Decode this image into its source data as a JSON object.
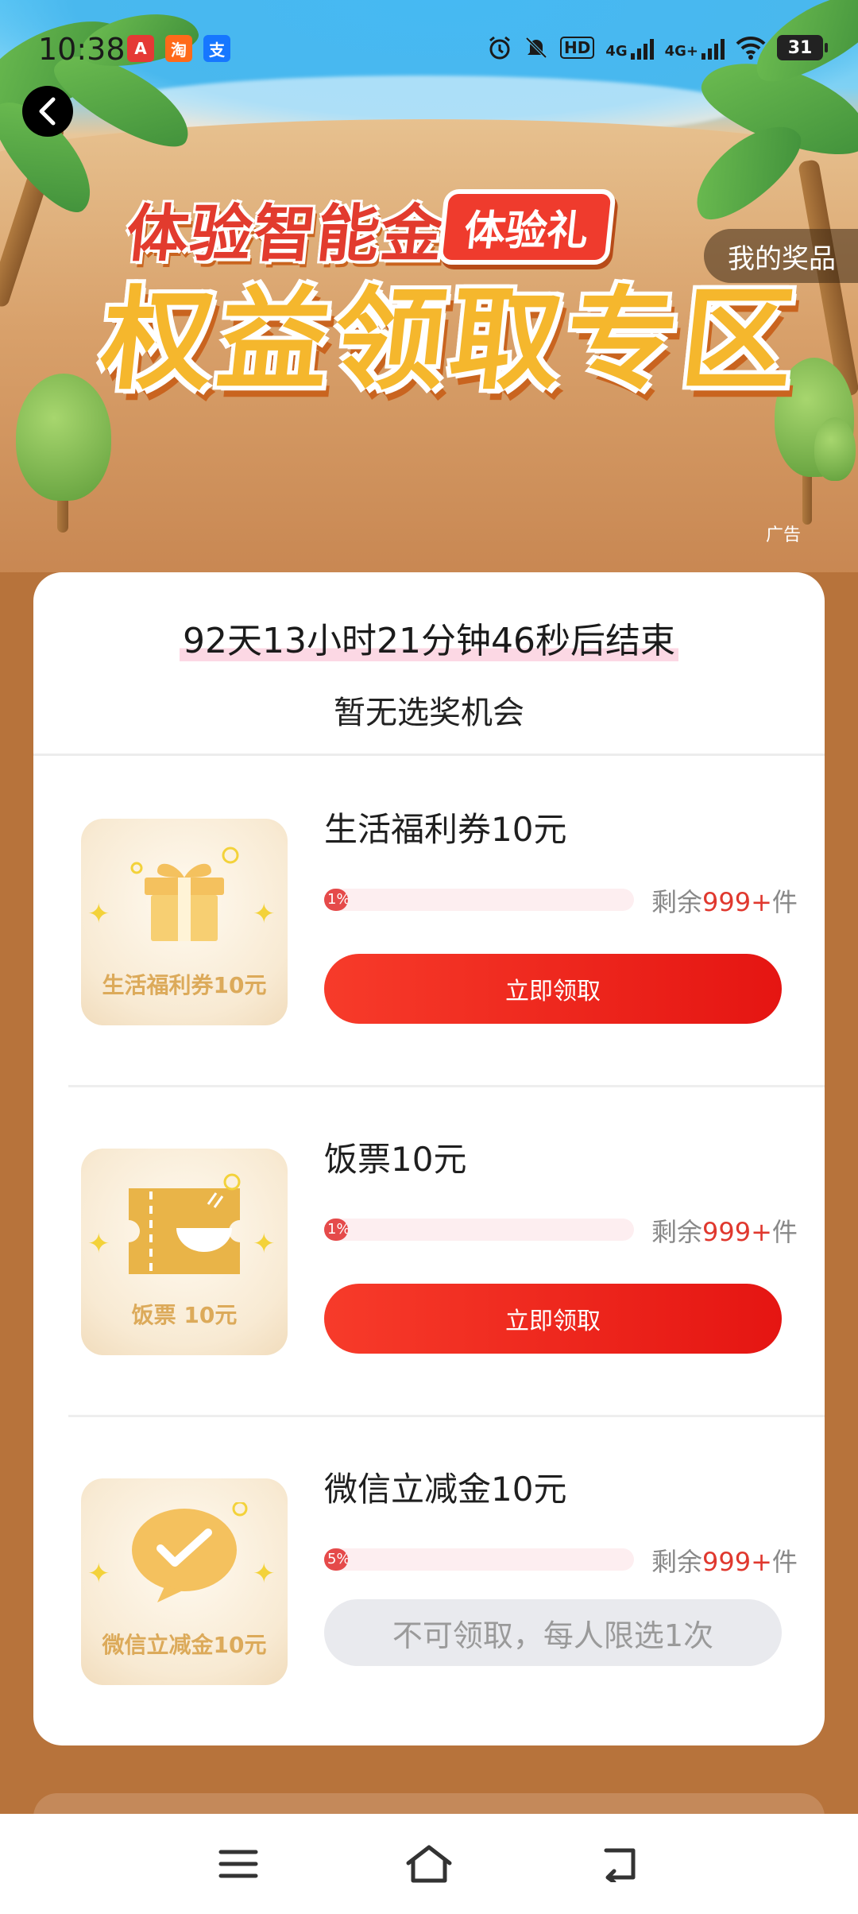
{
  "status_bar": {
    "time": "10:38",
    "apps": [
      {
        "icon": "app-red-a-icon",
        "color": "#e53935"
      },
      {
        "icon": "taobao-icon",
        "color": "#ff6a1a"
      },
      {
        "icon": "alipay-icon",
        "color": "#1677ff"
      }
    ],
    "indicators": [
      "alarm-icon",
      "mute-icon",
      "hd-icon",
      "signal-4g-icon",
      "signal-4g-plus-icon",
      "wifi-icon"
    ],
    "hd_label": "HD",
    "net1": "4G",
    "net2": "4G+",
    "battery": "31"
  },
  "header": {
    "title_line1": "体验智能金",
    "title_badge": "体验礼",
    "title_line2": "权益领取专区",
    "my_prize_label": "我的奖品",
    "ad_label": "广告"
  },
  "card": {
    "countdown": "92天13小时21分钟46秒后结束",
    "chance_text": "暂无选奖机会",
    "items": [
      {
        "name": "生活福利券10元",
        "image_caption": "生活福利券10元",
        "image_icon": "gift-box-icon",
        "progress_label": "1%",
        "progress": 0.05,
        "remain_prefix": "剩余",
        "remain_num": "999+",
        "remain_suffix": "件",
        "button": "立即领取",
        "enabled": true
      },
      {
        "name": "饭票10元",
        "image_caption": "饭票 10元",
        "image_icon": "meal-ticket-icon",
        "progress_label": "1%",
        "progress": 0.05,
        "remain_prefix": "剩余",
        "remain_num": "999+",
        "remain_suffix": "件",
        "button": "立即领取",
        "enabled": true
      },
      {
        "name": "微信立减金10元",
        "image_caption": "微信立减金10元",
        "image_icon": "wechat-pay-icon",
        "progress_label": "5%",
        "progress": 0.05,
        "remain_prefix": "剩余",
        "remain_num": "999+",
        "remain_suffix": "件",
        "button": "不可领取，每人限选1次",
        "enabled": false
      }
    ]
  },
  "nav": [
    "menu-icon",
    "home-icon",
    "back-nav-icon"
  ]
}
